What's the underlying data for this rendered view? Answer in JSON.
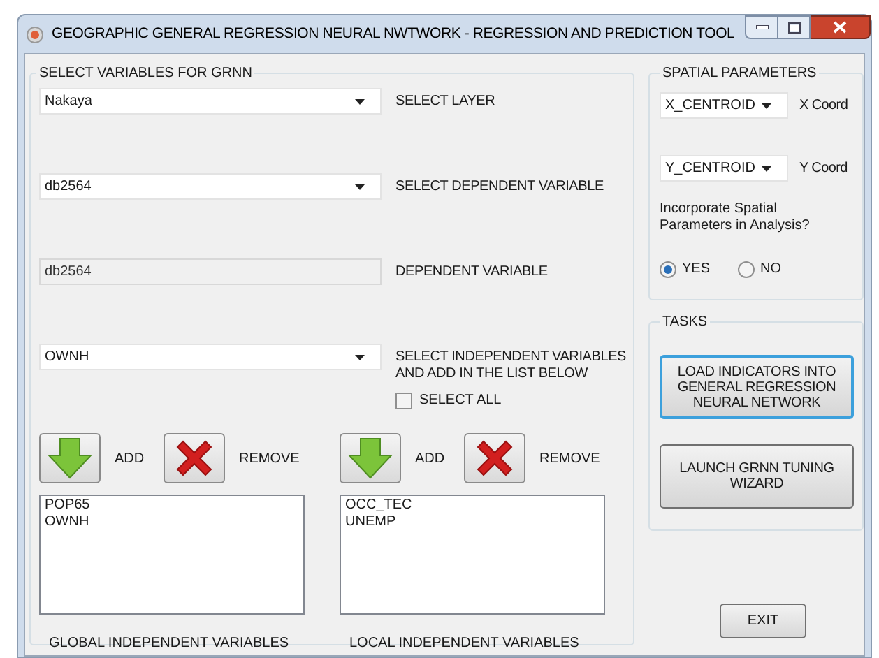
{
  "window": {
    "title": "GEOGRAPHIC GENERAL REGRESSION NEURAL NWTWORK - REGRESSION AND PREDICTION TOOL"
  },
  "variables_group": {
    "title": "SELECT VARIABLES FOR GRNN",
    "rows": [
      {
        "kind": "combo",
        "value": "Nakaya",
        "label": "SELECT LAYER"
      },
      {
        "kind": "combo",
        "value": "db2564",
        "label": "SELECT DEPENDENT VARIABLE"
      },
      {
        "kind": "textbox",
        "value": "db2564",
        "label": "DEPENDENT VARIABLE",
        "disabled": true
      },
      {
        "kind": "combo",
        "value": "OWNH",
        "label": "SELECT INDEPENDENT VARIABLES AND ADD IN THE LIST BELOW"
      }
    ],
    "select_all": {
      "label": "SELECT ALL",
      "checked": false
    },
    "lists": [
      {
        "add_label": "ADD",
        "remove_label": "REMOVE",
        "items": [
          "POP65",
          "OWNH"
        ],
        "caption": "GLOBAL INDEPENDENT VARIABLES"
      },
      {
        "add_label": "ADD",
        "remove_label": "REMOVE",
        "items": [
          "OCC_TEC",
          "UNEMP"
        ],
        "caption": "LOCAL INDEPENDENT VARIABLES"
      }
    ]
  },
  "spatial_parameters": {
    "title": "SPATIAL PARAMETERS",
    "coords": [
      {
        "value": "X_CENTROID",
        "label": "X Coord"
      },
      {
        "value": "Y_CENTROID",
        "label": "Y Coord"
      }
    ],
    "question": "Incorporate Spatial Parameters in Analysis?",
    "options": [
      {
        "label": "YES",
        "selected": true
      },
      {
        "label": "NO",
        "selected": false
      }
    ]
  },
  "tasks": {
    "title": "TASKS",
    "buttons": [
      {
        "label": "LOAD INDICATORS INTO GENERAL REGRESSION NEURAL NETWORK",
        "focused": true
      },
      {
        "label": "LAUNCH GRNN TUNING WIZARD",
        "focused": false
      }
    ]
  },
  "exit_button": {
    "label": "EXIT"
  }
}
